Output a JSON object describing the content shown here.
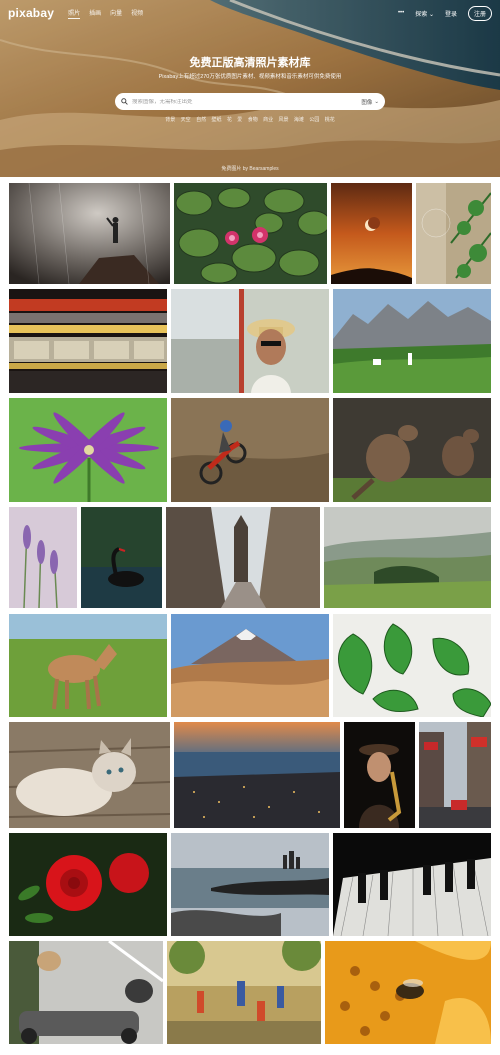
{
  "header": {
    "logo": "pixabay",
    "nav": [
      "照片",
      "插画",
      "向量",
      "视频"
    ],
    "more_icon": "•••",
    "explore": "探索",
    "login": "登录",
    "join": "注册"
  },
  "hero": {
    "title": "免费正版高清照片素材库",
    "subtitle": "Pixabay上有超过270万张优质图片素材、视频素材和音乐素材可供免费使用",
    "search_placeholder": "搜索图像，无需标注出处",
    "search_type": "图像",
    "tags": [
      "背景",
      "天空",
      "自然",
      "壁纸",
      "花",
      "爱",
      "食物",
      "商业",
      "风景",
      "海滩",
      "公园",
      "桃花"
    ],
    "credit": "免费图片 by Bearsamples"
  },
  "colors": {
    "accent": "#ffffff",
    "search_bg": "#ffffff"
  },
  "photos": [
    {
      "name": "man-in-rain-photo"
    },
    {
      "name": "water-lilies-photo"
    },
    {
      "name": "moon-sunset-photo"
    },
    {
      "name": "pine-branch-photo"
    },
    {
      "name": "train-motion-photo"
    },
    {
      "name": "woman-hat-photo"
    },
    {
      "name": "mountain-village-photo"
    },
    {
      "name": "purple-flower-photo"
    },
    {
      "name": "motocross-photo"
    },
    {
      "name": "kangaroos-photo"
    },
    {
      "name": "lavender-photo"
    },
    {
      "name": "black-swan-photo"
    },
    {
      "name": "old-street-photo"
    },
    {
      "name": "foggy-landscape-photo"
    },
    {
      "name": "horse-foal-photo"
    },
    {
      "name": "volcano-desert-photo"
    },
    {
      "name": "green-plant-photo"
    },
    {
      "name": "cat-photo"
    },
    {
      "name": "harbor-city-photo"
    },
    {
      "name": "saxophone-woman-photo"
    },
    {
      "name": "city-street-photo"
    },
    {
      "name": "red-rose-photo"
    },
    {
      "name": "rocky-coast-photo"
    },
    {
      "name": "piano-keys-photo"
    },
    {
      "name": "dogs-motorbike-photo"
    },
    {
      "name": "children-playing-photo"
    },
    {
      "name": "bee-flower-photo"
    }
  ]
}
